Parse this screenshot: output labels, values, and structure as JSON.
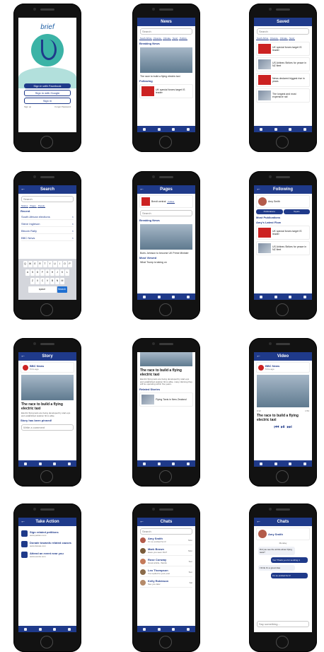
{
  "screens": {
    "login": {
      "logo": "brief",
      "btn_facebook": "Sign in with Facebook",
      "btn_google": "Sign in with Google",
      "btn_signin": "Sign in",
      "link_signup": "Sign up",
      "link_forgot": "Forgot Password"
    },
    "news": {
      "title": "News",
      "search_placeholder": "Search",
      "chips": [
        "South Africa",
        "Finance",
        "Climate",
        "Sport",
        "Politics"
      ],
      "section_breaking": "Breaking News",
      "story": "The race to build a flying electric taxi",
      "section_following": "Following",
      "following_item": "UK special forces target IS leader"
    },
    "saved": {
      "title": "Saved",
      "search_placeholder": "Search",
      "chips": [
        "South Africa",
        "Finance",
        "Climate",
        "Sport",
        "Politics"
      ],
      "items": [
        "UK special forces target IS leader",
        "US Airlines Strikes for peace in NZ fleet",
        "News declared biggest rise in years",
        "The longest and most expensive rail"
      ]
    },
    "search": {
      "title": "Search",
      "placeholder": "Search",
      "tabs": [
        "Stories",
        "Pages",
        "People"
      ],
      "section_recent": "Recent",
      "recent": [
        "South African elections",
        "Steve Ingleson",
        "Bitcoin Rally",
        "BBC News"
      ]
    },
    "pages": {
      "title": "Pages",
      "page_name": "Brexit central",
      "page_follow": "Follow",
      "search_placeholder": "Search",
      "section_breaking": "Breaking News",
      "story": "Boris Johnson to become UK Prime Minister",
      "section_most_viewed": "Most Viewed",
      "most_viewed": "What Trump is taking on"
    },
    "following": {
      "title": "Following",
      "profile_name": "Amy Smith",
      "btn_publications": "Publications",
      "btn_topics": "Topics",
      "section_publications": "Most Publications",
      "section_live": "Amy's Latest Flow",
      "items": [
        "UK special forces target IS leader",
        "US Airlines Strikes for peace in NZ fleet"
      ]
    },
    "story": {
      "title": "Story",
      "source": "BBC News",
      "time": "5 hrs ago",
      "headline": "The race to build a flying electric taxi",
      "body": "Electric flying taxis are being developed by start-ups and established aviation firms alike.",
      "saved_label": "Story has been pinned!",
      "comment_placeholder": "Write a comment"
    },
    "article": {
      "headline": "The race to build a flying electric taxi",
      "body": "Electric flying taxis are being developed by start-ups and established aviation firms alike, many claiming they will be operating within five years.",
      "section_related": "Related Stories",
      "related": "Flying Taxis in New Zealand"
    },
    "video": {
      "title": "Video",
      "source": "BBC News",
      "time": "5 hrs ago",
      "headline": "The race to build a flying electric taxi",
      "time_elapsed": "0:12",
      "time_total": "1:54"
    },
    "take_action": {
      "title": "Take Action",
      "items": [
        {
          "title": "Sign related petitions",
          "sub": "www.petition.com"
        },
        {
          "title": "Donate towards related causes",
          "sub": "www.donate.com"
        },
        {
          "title": "Attend an event near you",
          "sub": "www.events.com"
        }
      ]
    },
    "chats": {
      "title": "Chats",
      "search_placeholder": "Search",
      "rows": [
        {
          "name": "Amy Smith",
          "msg": "I'm so excited for it!",
          "when": "Mon"
        },
        {
          "name": "Mark Brown",
          "msg": "Have you seen this?",
          "when": "Mon"
        },
        {
          "name": "Rose Conway",
          "msg": "Great article, thanks",
          "when": "Sun"
        },
        {
          "name": "Leo Thompson",
          "msg": "I've replied to your post",
          "when": "Sun"
        },
        {
          "name": "Kelly Robinson",
          "msg": "See you later",
          "when": "Sat"
        }
      ]
    },
    "chat": {
      "title": "Chats",
      "contact": "Amy Smith",
      "day": "Monday",
      "msgs": [
        "Did you see the article about flying taxis?",
        "Yes! Thank you for sending it.",
        "I think it's a great idea",
        "I'm so excited for it!"
      ],
      "input_placeholder": "Say something..."
    }
  }
}
